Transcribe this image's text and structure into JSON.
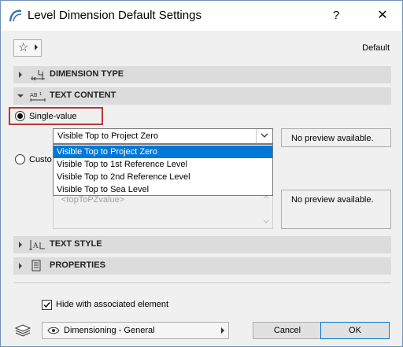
{
  "window": {
    "title": "Level Dimension Default Settings",
    "help_label": "?",
    "close_label": "✕"
  },
  "header": {
    "default_label": "Default",
    "favorites_icon": "star-icon"
  },
  "panels": {
    "dimension_type": "DIMENSION TYPE",
    "text_content": "TEXT CONTENT",
    "text_style": "TEXT STYLE",
    "properties": "PROPERTIES"
  },
  "text_content": {
    "single_value_label": "Single-value",
    "custom_label": "Custo",
    "selected_value": "Visible Top to Project Zero",
    "options": [
      "Visible Top to Project Zero",
      "Visible Top to 1st Reference Level",
      "Visible Top to 2nd Reference Level",
      "Visible Top to Sea Level"
    ],
    "preview_text_1": "No preview available.",
    "preview_text_2": "No preview available.",
    "custom_text": "<topToPZvalue>"
  },
  "footer": {
    "hide_label": "Hide with associated element",
    "hide_checked": true,
    "layer_value": "Dimensioning - General",
    "cancel_label": "Cancel",
    "ok_label": "OK"
  }
}
